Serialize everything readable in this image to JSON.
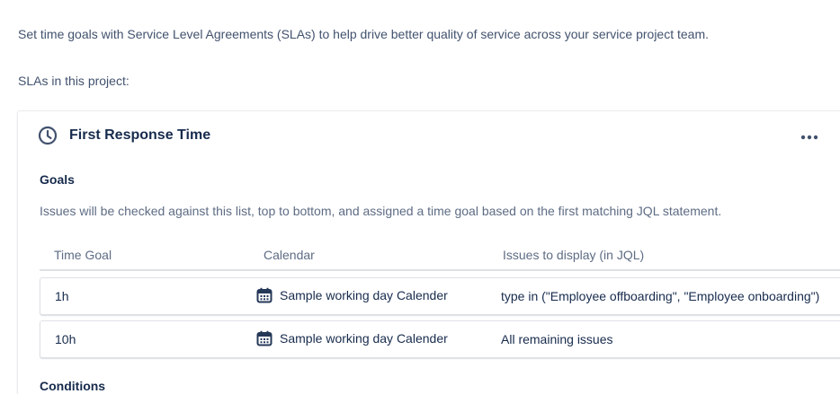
{
  "intro_text": "Set time goals with Service Level Agreements (SLAs) to help drive better quality of service across your service project team.",
  "slas_label": "SLAs in this project:",
  "sla": {
    "icon": "clock-icon",
    "title": "First Response Time",
    "more_icon": "more-horizontal-icon",
    "goals": {
      "heading": "Goals",
      "description": "Issues will be checked against this list, top to bottom, and assigned a time goal based on the first matching JQL statement.",
      "columns": {
        "time_goal": "Time Goal",
        "calendar": "Calendar",
        "jql": "Issues to display (in JQL)"
      },
      "rows": [
        {
          "time_goal": "1h",
          "calendar_icon": "calendar-icon",
          "calendar": "Sample working day Calender",
          "jql": "type in (\"Employee offboarding\", \"Employee onboarding\")"
        },
        {
          "time_goal": "10h",
          "calendar_icon": "calendar-icon",
          "calendar": "Sample working day Calender",
          "jql": "All remaining issues"
        }
      ]
    },
    "conditions_heading": "Conditions"
  },
  "colors": {
    "heading_text": "#172b4d",
    "body_text": "#42526e",
    "subtle_text": "#5e6c84",
    "border": "#dfe1e6"
  }
}
